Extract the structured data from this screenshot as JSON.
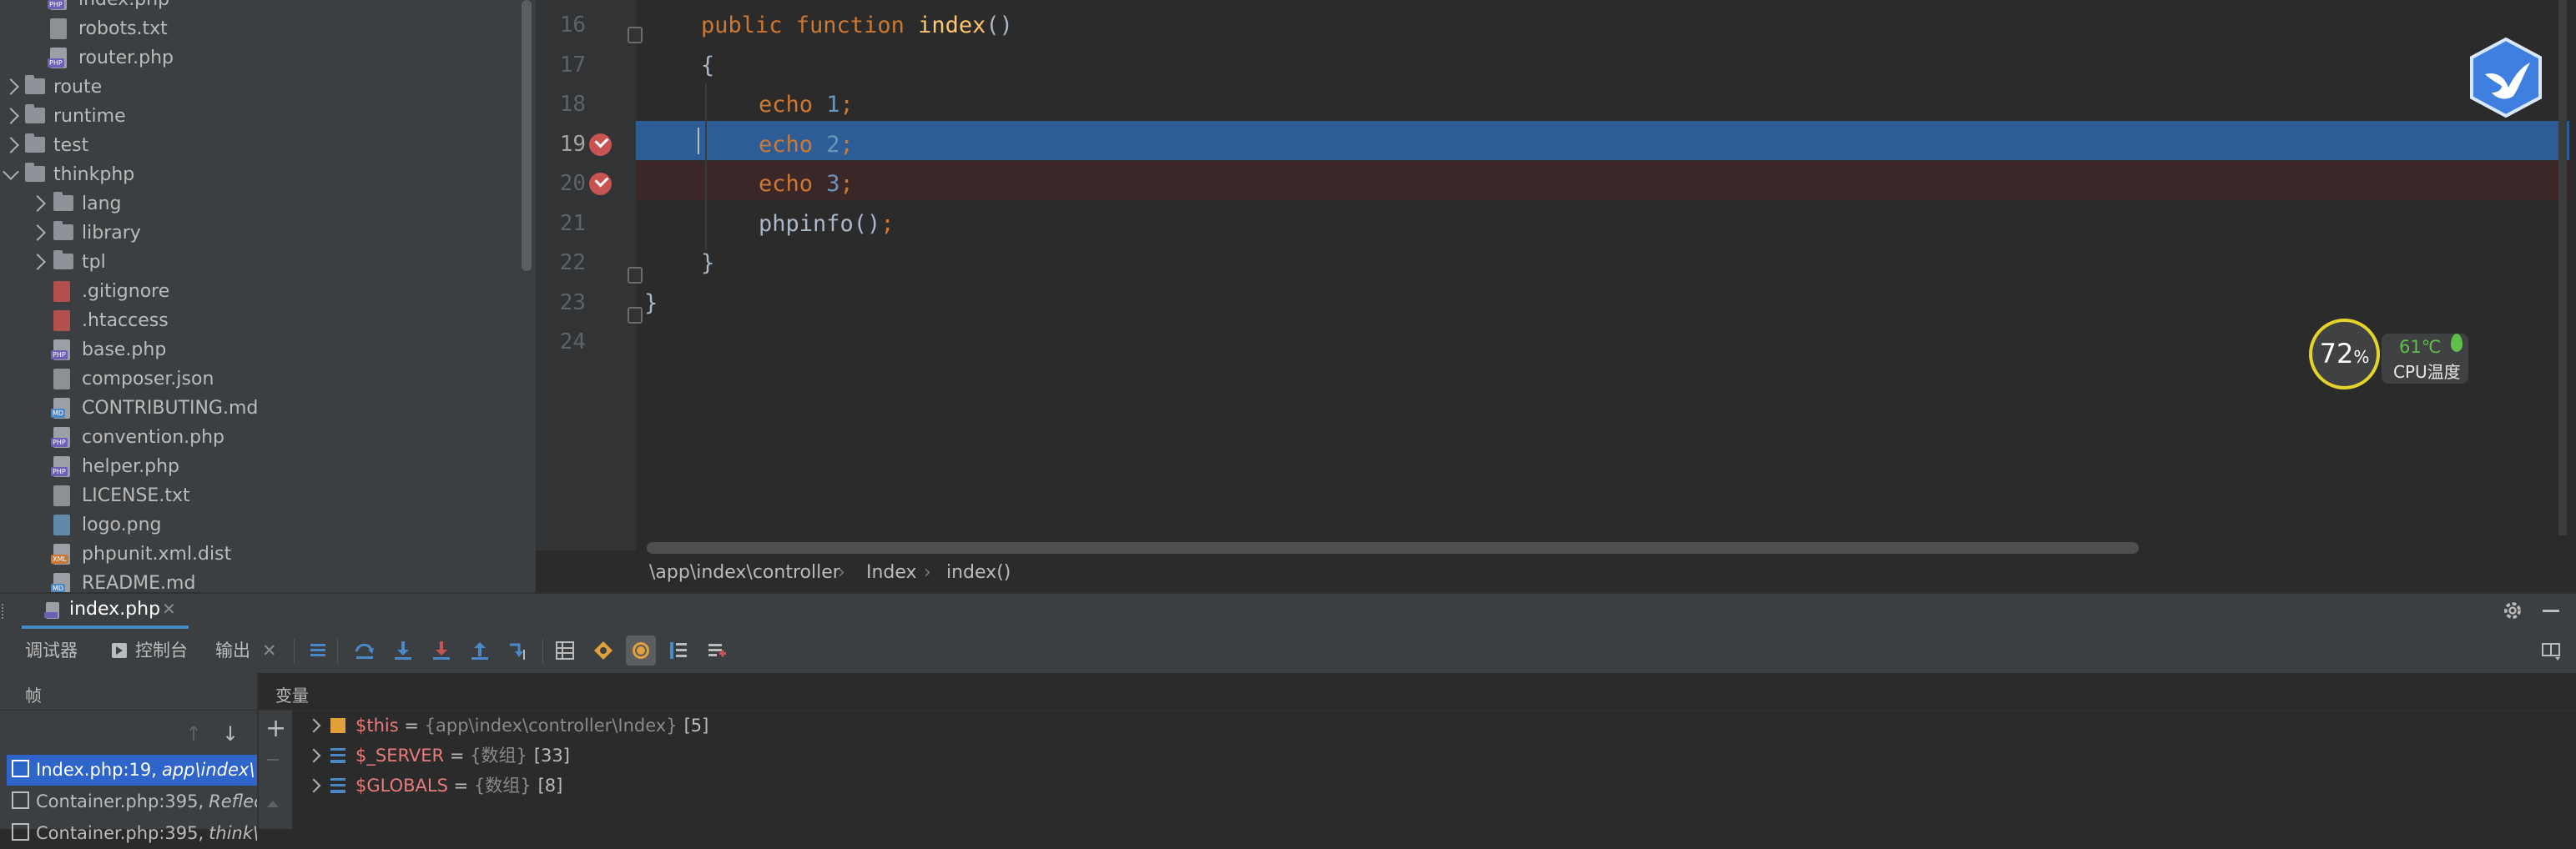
{
  "project_tree": {
    "items": [
      {
        "label": "index.php",
        "kind": "php"
      },
      {
        "label": "robots.txt",
        "kind": "txt"
      },
      {
        "label": "router.php",
        "kind": "php"
      },
      {
        "label": "route",
        "kind": "folder"
      },
      {
        "label": "runtime",
        "kind": "folder"
      },
      {
        "label": "test",
        "kind": "folder"
      },
      {
        "label": "thinkphp",
        "kind": "folder-open"
      },
      {
        "label": "lang",
        "kind": "folder"
      },
      {
        "label": "library",
        "kind": "folder"
      },
      {
        "label": "tpl",
        "kind": "folder"
      },
      {
        "label": ".gitignore",
        "kind": "git"
      },
      {
        "label": ".htaccess",
        "kind": "config"
      },
      {
        "label": "base.php",
        "kind": "php"
      },
      {
        "label": "composer.json",
        "kind": "json"
      },
      {
        "label": "CONTRIBUTING.md",
        "kind": "md"
      },
      {
        "label": "convention.php",
        "kind": "php"
      },
      {
        "label": "helper.php",
        "kind": "php"
      },
      {
        "label": "LICENSE.txt",
        "kind": "txt"
      },
      {
        "label": "logo.png",
        "kind": "image"
      },
      {
        "label": "phpunit.xml.dist",
        "kind": "xml"
      },
      {
        "label": "README.md",
        "kind": "md"
      }
    ]
  },
  "editor": {
    "line_numbers": [
      "16",
      "17",
      "18",
      "19",
      "20",
      "21",
      "22",
      "23",
      "24"
    ],
    "lines": [
      {
        "tokens": [
          [
            "kw",
            "public function "
          ],
          [
            "fn",
            "index"
          ],
          [
            "plain",
            "()"
          ]
        ]
      },
      {
        "tokens": [
          [
            "plain",
            "{"
          ]
        ]
      },
      {
        "tokens": [
          [
            "kw",
            "echo "
          ],
          [
            "num",
            "1"
          ],
          [
            "kw",
            ";"
          ]
        ]
      },
      {
        "tokens": [
          [
            "kw",
            "echo "
          ],
          [
            "num",
            "2"
          ],
          [
            "kw",
            ";"
          ]
        ]
      },
      {
        "tokens": [
          [
            "kw",
            "echo "
          ],
          [
            "num",
            "3"
          ],
          [
            "kw",
            ";"
          ]
        ]
      },
      {
        "tokens": [
          [
            "plain",
            "phpinfo()"
          ],
          [
            "kw",
            ";"
          ]
        ]
      },
      {
        "tokens": [
          [
            "plain",
            "}"
          ]
        ]
      },
      {
        "tokens": [
          [
            "plain",
            "}"
          ]
        ]
      },
      {
        "tokens": []
      }
    ],
    "current_line": "19",
    "breakpoint_lines": [
      "19",
      "20"
    ],
    "breadcrumb": [
      "\\app\\index\\controller",
      "Index",
      "index()"
    ]
  },
  "cpu_widget": {
    "usage": "72",
    "usage_unit": "%",
    "temperature": "61℃",
    "label": "CPU温度"
  },
  "debug_panel": {
    "session_tab": "index.php",
    "tabs": [
      "调试器",
      "控制台",
      "输出"
    ],
    "frames_header": "帧",
    "variables_header": "变量",
    "frames": [
      {
        "file": "Index.php:19,",
        "context": "app\\index\\",
        "selected": true
      },
      {
        "file": "Container.php:395,",
        "context": "Reflec",
        "selected": false
      },
      {
        "file": "Container.php:395,",
        "context": "think\\",
        "selected": false
      }
    ],
    "variables": [
      {
        "name": "$this",
        "eq": " = ",
        "type": "{app\\index\\controller\\Index}",
        "count": "[5]"
      },
      {
        "name": "$_SERVER",
        "eq": " = ",
        "type": "{数组}",
        "count": "[33]"
      },
      {
        "name": "$GLOBALS",
        "eq": " = ",
        "type": "{数组}",
        "count": "[8]"
      }
    ]
  },
  "colors": {
    "keyword": "#cc7832",
    "function": "#ffc66d",
    "number": "#6897bb",
    "current_line": "#2d5d96",
    "breakpoint": "#c75450",
    "selection": "#2f65ca"
  }
}
